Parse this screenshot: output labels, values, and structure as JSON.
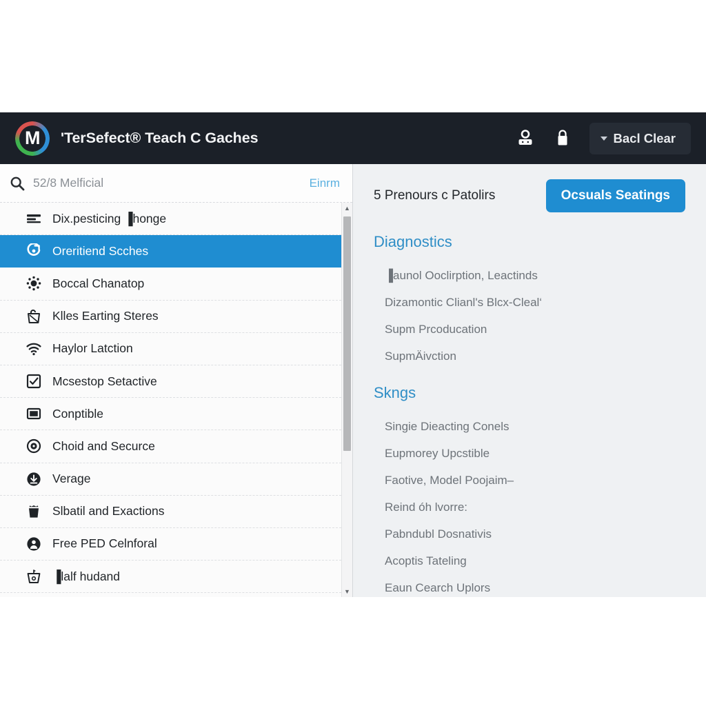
{
  "header": {
    "logo_letter": "M",
    "logo_name": "app-logo",
    "title": "'TerSefect® Teach C Gaches",
    "icons": [
      {
        "name": "user-profile-icon",
        "glyph": "person"
      },
      {
        "name": "lock-icon",
        "glyph": "lock"
      }
    ],
    "dropdown_button": {
      "label": "Bacl Clear",
      "caret": "chevron-down-icon"
    },
    "colors": {
      "background": "#1b2028",
      "button_background": "#262c35",
      "text": "#f2f3f5"
    }
  },
  "sidebar": {
    "search": {
      "icon": "search-icon",
      "placeholder": "52/8 Melficial",
      "value": "",
      "action_label": "Einrm"
    },
    "items": [
      {
        "label": "Dix.pesticing ▐honge",
        "icon": "stack-lines-icon",
        "selected": false
      },
      {
        "label": "Oreritiend Scches",
        "icon": "target-arrow-icon",
        "selected": true
      },
      {
        "label": "Boccal Chanatop",
        "icon": "gear-dotted-icon",
        "selected": false
      },
      {
        "label": "Klles Earting Steres",
        "icon": "bag-icon",
        "selected": false
      },
      {
        "label": "Haylor Latction",
        "icon": "wifi-icon",
        "selected": false
      },
      {
        "label": "Mcsestop Setactive",
        "icon": "checkbox-icon",
        "selected": false
      },
      {
        "label": "Conptible",
        "icon": "image-frame-icon",
        "selected": false
      },
      {
        "label": "Choid and Securce",
        "icon": "record-dot-icon",
        "selected": false
      },
      {
        "label": "Verage",
        "icon": "download-icon",
        "selected": false
      },
      {
        "label": "Slbatil and Exactions",
        "icon": "trash-icon",
        "selected": false
      },
      {
        "label": "Free PED Celnforal",
        "icon": "user-badge-icon",
        "selected": false
      },
      {
        "label": "▐lalf hudand",
        "icon": "basket-icon",
        "selected": false
      }
    ],
    "scrollbar": {
      "up_arrow": "▲",
      "down_arrow": "▼"
    },
    "colors": {
      "selected_background": "#1f8dd1",
      "panel_background": "#fbfbfb"
    }
  },
  "details": {
    "title": "5 Prenours c Patolirs",
    "primary_button": "Ocsuals Seatings",
    "sections": [
      {
        "heading": "Diagnostics",
        "items": [
          "▐aunol Ooclirption, Leactinds",
          "Dizamontic Clianl's Blcx-Cleal‘",
          "Supm Prcoducation",
          "SupmÄivction"
        ]
      },
      {
        "heading": "Skngs",
        "items": [
          "Singie Dieacting Conels",
          "Eupmorey Upcstible",
          "Faotive, Model Poojaim–",
          "Reind óh lvorre:",
          "Pabndubl Dosnativis",
          "Acoptis Tateling",
          "Eaun  Cearch Uplors"
        ]
      }
    ],
    "colors": {
      "background": "#eff1f3",
      "accent": "#2f8ec6",
      "button": "#1f8dd1"
    }
  }
}
